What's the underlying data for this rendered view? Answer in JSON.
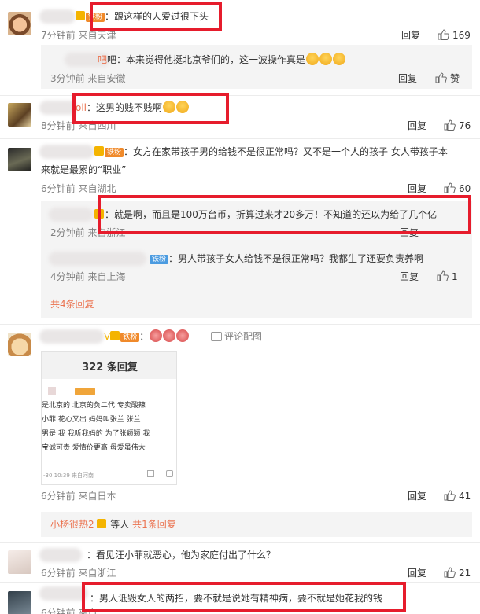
{
  "reply_label": "回复",
  "comments": [
    {
      "text": "：跟这样的人爱过很下头",
      "meta": "7分钟前 来自天津",
      "likes": "169"
    },
    {
      "text": "吧：本来觉得他挺北京爷们的，这一波操作真是",
      "meta": "3分钟前 来自安徽",
      "likes": "赞"
    },
    {
      "name_frag": "oll",
      "text": "：这男的贱不贱啊",
      "meta": "8分钟前 来自四川",
      "likes": "76"
    },
    {
      "text_line1": "：女方在家带孩子男的给钱不是很正常吗？又不是一个人的孩子 女人带孩子本",
      "text_line2": "来就是最累的“职业”",
      "meta": "6分钟前 来自湖北",
      "likes": "60"
    },
    {
      "text": "：就是啊，而且是100万台币，折算过来才20多万！不知道的还以为给了几个亿",
      "meta": "2分钟前 来自浙江",
      "likes": ""
    },
    {
      "text": "：男人带孩子女人给钱不是很正常吗？我都生了还要负责养啊",
      "meta": "4分钟前 来自上海",
      "likes": "1"
    },
    {
      "text": "评论配图",
      "meta": "6分钟前 来自日本",
      "likes": "41"
    },
    {
      "text": "：看见汪小菲就恶心，他为家庭付出了什么？",
      "meta": "6分钟前 来自浙江",
      "likes": "21"
    },
    {
      "text": "：男人诋毁女人的两招，要不就是说她有精神病，要不就是她花我的钱",
      "meta": "6分钟前 来自",
      "likes": ""
    }
  ],
  "badges": {
    "fan": "铁粉"
  },
  "more_replies": "共4条回复",
  "hot_user": "小杨很热2",
  "hot_suffix": "等人",
  "hot_count": "共1条回复",
  "image_card": {
    "title": "322 条回复",
    "line1": "是北京的 北京的负二代 专卖酸辣",
    "line2": "小菲 花心又出",
    "line2b": "妈妈叫张兰 张兰",
    "line3": "男是 我 我听我妈的 为了张颖颖 我",
    "line4": "宝诚可贵 爱情价更高 母爱虽伟大",
    "footer": "-30 10:39 来自河南"
  }
}
